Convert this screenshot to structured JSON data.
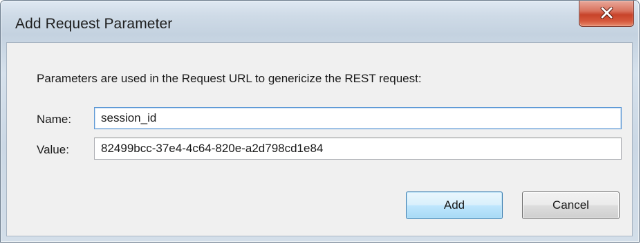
{
  "window": {
    "title": "Add Request Parameter"
  },
  "dialog": {
    "description": "Parameters are used in the Request URL  to genericize the REST request:",
    "name_label": "Name:",
    "name_value": "session_id",
    "value_label": "Value:",
    "value_value": "82499bcc-37e4-4c64-820e-a2d798cd1e84"
  },
  "buttons": {
    "add_label": "Add",
    "cancel_label": "Cancel"
  },
  "icons": {
    "close": "close-icon"
  },
  "colors": {
    "close_button": "#c7432a",
    "focused_input_border": "#5e99d6",
    "default_button_border": "#3c7fb1"
  }
}
